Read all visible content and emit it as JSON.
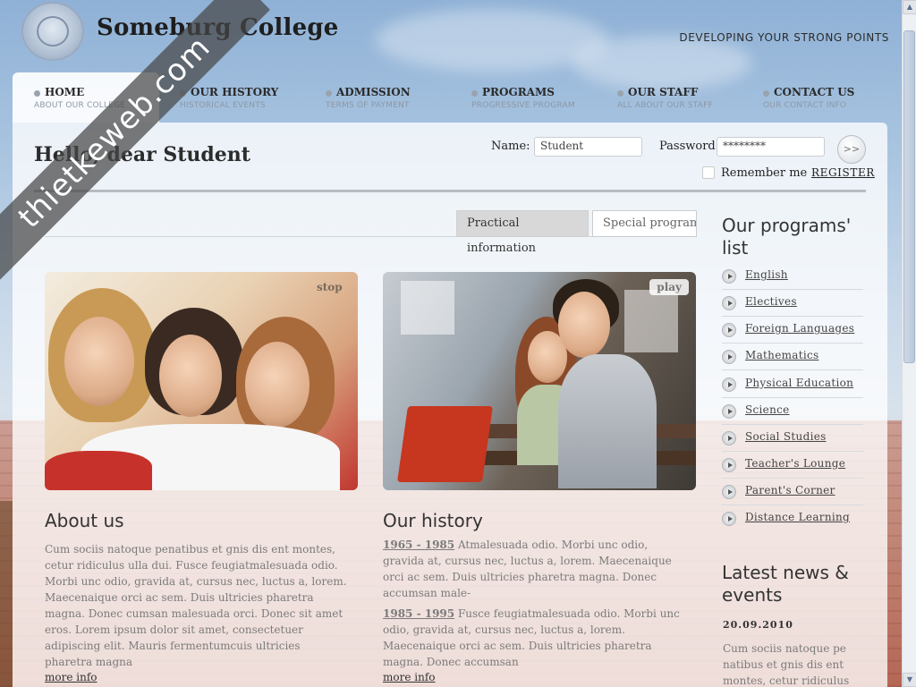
{
  "header": {
    "site_title": "Someburg College",
    "tagline": "DEVELOPING YOUR STRONG POINTS"
  },
  "nav": [
    {
      "title": "HOME",
      "sub": "ABOUT OUR COLLEGE"
    },
    {
      "title": "OUR HISTORY",
      "sub": "HISTORICAL EVENTS"
    },
    {
      "title": "ADMISSION",
      "sub": "TERMS OF PAYMENT"
    },
    {
      "title": "PROGRAMS",
      "sub": "PROGRESSIVE PROGRAM"
    },
    {
      "title": "OUR STAFF",
      "sub": "ALL ABOUT OUR STAFF"
    },
    {
      "title": "CONTACT US",
      "sub": "OUR CONTACT INFO"
    }
  ],
  "login": {
    "greeting": "Hello, dear Student",
    "name_label": "Name:",
    "name_value": "Student",
    "password_label": "Password:",
    "password_value": "********",
    "go_label": ">>",
    "remember_label": "Remember me",
    "register_label": "REGISTER"
  },
  "tabs": {
    "active": "Practical information",
    "inactive": "Special programs"
  },
  "slider": {
    "stop_label": "stop",
    "play_label": "play"
  },
  "about": {
    "title": "About us",
    "text": "Cum sociis natoque penatibus et gnis dis ent montes, cetur ridiculus ulla dui. Fusce feugiatmalesuada odio. Morbi unc odio, gravida at, cursus nec, luctus a, lorem. Maecenaique orci ac sem. Duis ultricies pharetra magna. Donec cumsan malesuada orci. Donec sit amet eros. Lorem ipsum dolor sit amet, consectetuer adipiscing elit. Mauris fermentumcuis ultricies pharetra magna",
    "more": "more info"
  },
  "history": {
    "title": "Our history",
    "entry1_year": "1965 - 1985",
    "entry1_text": " Atmalesuada odio. Morbi unc odio, gravida at, cursus nec, luctus a, lorem. Maecenaique orci ac sem. Duis ultricies pharetra magna. Donec accumsan male-",
    "entry2_year": "1985 - 1995",
    "entry2_text": " Fusce feugiatmalesuada odio. Morbi unc odio, gravida at, cursus nec, luctus a, lorem. Maecenaique orci ac sem. Duis ultricies pharetra magna. Donec accumsan",
    "more": "more info"
  },
  "sidebar": {
    "programs_title_1": "Our programs'",
    "programs_title_2": "list",
    "programs": [
      "English",
      "Electives",
      "Foreign Languages",
      "Mathematics",
      "Physical Education",
      "Science",
      "Social Studies",
      "Teacher's Lounge",
      "Parent's Corner",
      "Distance Learning"
    ],
    "news_title_1": "Latest news &",
    "news_title_2": "events",
    "news_date": "20.09.2010",
    "news_text": "Cum sociis natoque pe natibus et gnis dis ent montes, cetur ridiculus"
  },
  "watermark": "thietkeweb.com",
  "scrollbar": {
    "up": "▲",
    "down": "▼"
  },
  "colors": {
    "panel": "#ffffff",
    "nav_sub": "#8d98a4",
    "body_text": "#7b7b7b",
    "heading": "#333333"
  }
}
